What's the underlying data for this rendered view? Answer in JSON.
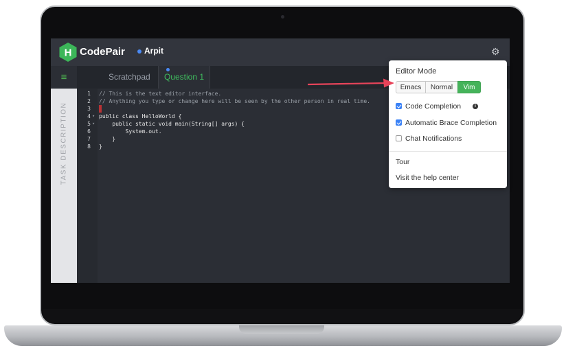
{
  "app": {
    "brand": "CodePair",
    "logo_letter": "H",
    "user_name": "Arpit"
  },
  "tabs": {
    "items": [
      {
        "label": "Scratchpad"
      },
      {
        "label": "Question 1"
      }
    ]
  },
  "side_panel": {
    "label": "TASK DESCRIPTION"
  },
  "editor": {
    "lines": [
      {
        "num": "1",
        "text": "// This is the text editor interface."
      },
      {
        "num": "2",
        "text": "// Anything you type or change here will be seen by the other person in real time."
      },
      {
        "num": "3",
        "text": ""
      },
      {
        "num": "4",
        "text": "public class HelloWorld {"
      },
      {
        "num": "5",
        "text": "    public static void main(String[] args) {"
      },
      {
        "num": "6",
        "text": "        System.out."
      },
      {
        "num": "7",
        "text": "    }"
      },
      {
        "num": "8",
        "text": "}"
      }
    ]
  },
  "settings": {
    "title": "Editor Mode",
    "modes": [
      "Emacs",
      "Normal",
      "Vim"
    ],
    "selected_mode": "Vim",
    "options": [
      {
        "label": "Code Completion",
        "checked": true
      },
      {
        "label": "Automatic Brace Completion",
        "checked": true
      },
      {
        "label": "Chat Notifications",
        "checked": false
      }
    ],
    "links": [
      "Tour",
      "Visit the help center"
    ]
  },
  "colors": {
    "accent_green": "#45b35a",
    "tab_active": "#3fbf5f",
    "checkbox_blue": "#3b82f6",
    "annotation_arrow": "#e8445a",
    "user_dot": "#4a8af4"
  },
  "icons": [
    "hackerrank-logo",
    "gear-icon",
    "hamburger-menu-icon",
    "info-icon",
    "checkbox-icon"
  ]
}
